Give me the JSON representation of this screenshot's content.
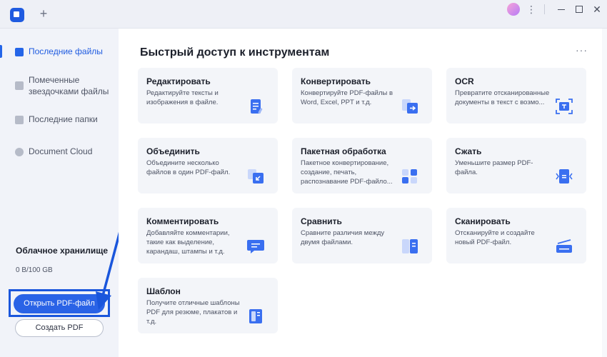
{
  "titlebar": {
    "new_tab_symbol": "+",
    "kebab_symbol": "⋮",
    "close_symbol": "✕"
  },
  "sidebar": {
    "items": [
      {
        "label": "Последние файлы",
        "icon": "recent-files-icon",
        "active": true
      },
      {
        "label": "Помеченные звездочками файлы",
        "icon": "starred-files-icon"
      },
      {
        "label": "Последние папки",
        "icon": "folder-icon"
      },
      {
        "label": "Document Cloud",
        "icon": "cloud-icon"
      }
    ],
    "storage": {
      "title": "Облачное хранилище",
      "value": "0 B/100 GB",
      "used_fraction": 0
    },
    "open_pdf_label": "Открыть PDF-файл",
    "create_pdf_label": "Создать PDF"
  },
  "main": {
    "title": "Быстрый доступ к инструментам",
    "more_symbol": "···",
    "tools": [
      {
        "title": "Редактировать",
        "desc": "Редактируйте тексты и изображения в файле.",
        "icon": "edit-icon"
      },
      {
        "title": "Конвертировать",
        "desc": "Конвертируйте PDF-файлы в Word, Excel, PPT и т.д.",
        "icon": "convert-icon"
      },
      {
        "title": "OCR",
        "desc": "Превратите отсканированные документы в текст с возмо...",
        "icon": "ocr-icon"
      },
      {
        "title": "Объединить",
        "desc": "Объедините несколько файлов в один PDF-файл.",
        "icon": "combine-icon"
      },
      {
        "title": "Пакетная обработка",
        "desc": "Пакетное конвертирование, создание, печать, распознавание PDF-файло...",
        "icon": "batch-icon"
      },
      {
        "title": "Сжать",
        "desc": "Уменьшите размер PDF-файла.",
        "icon": "compress-icon"
      },
      {
        "title": "Комментировать",
        "desc": "Добавляйте комментарии, такие как выделение, карандаш, штампы и т.д.",
        "icon": "comment-icon"
      },
      {
        "title": "Сравнить",
        "desc": "Сравните различия между двумя файлами.",
        "icon": "compare-icon"
      },
      {
        "title": "Сканировать",
        "desc": "Отсканируйте и создайте новый PDF-файл.",
        "icon": "scan-icon"
      },
      {
        "title": "Шаблон",
        "desc": "Получите отличные шаблоны PDF для резюме, плакатов и т.д.",
        "icon": "template-icon"
      }
    ]
  },
  "colors": {
    "accent": "#2a63e6",
    "highlight_box": "#1a56dc",
    "sidebar_bg": "#f1f3f9",
    "card_bg": "#f3f5f9"
  }
}
